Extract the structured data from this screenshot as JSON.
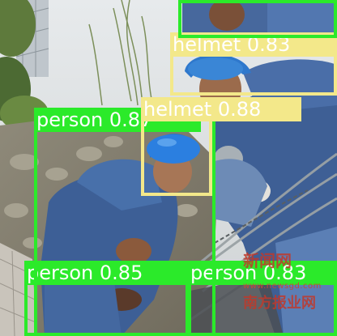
{
  "colors": {
    "person": "#2bea2a",
    "helmet": "#f3e88a"
  },
  "detections": [
    {
      "cls": "person",
      "label": "person 0.85"
    },
    {
      "cls": "person",
      "label": "person 0.83"
    },
    {
      "cls": "person",
      "label": "person 0.87"
    },
    {
      "cls": "helmet",
      "label": "helmet 0.88"
    },
    {
      "cls": "helmet",
      "label": "helmet 0.83"
    },
    {
      "cls": "person",
      "label": ""
    }
  ],
  "watermark": {
    "url": "www.newsgd.com",
    "text_top": "新闻网",
    "text_bottom": "南方报业网"
  }
}
